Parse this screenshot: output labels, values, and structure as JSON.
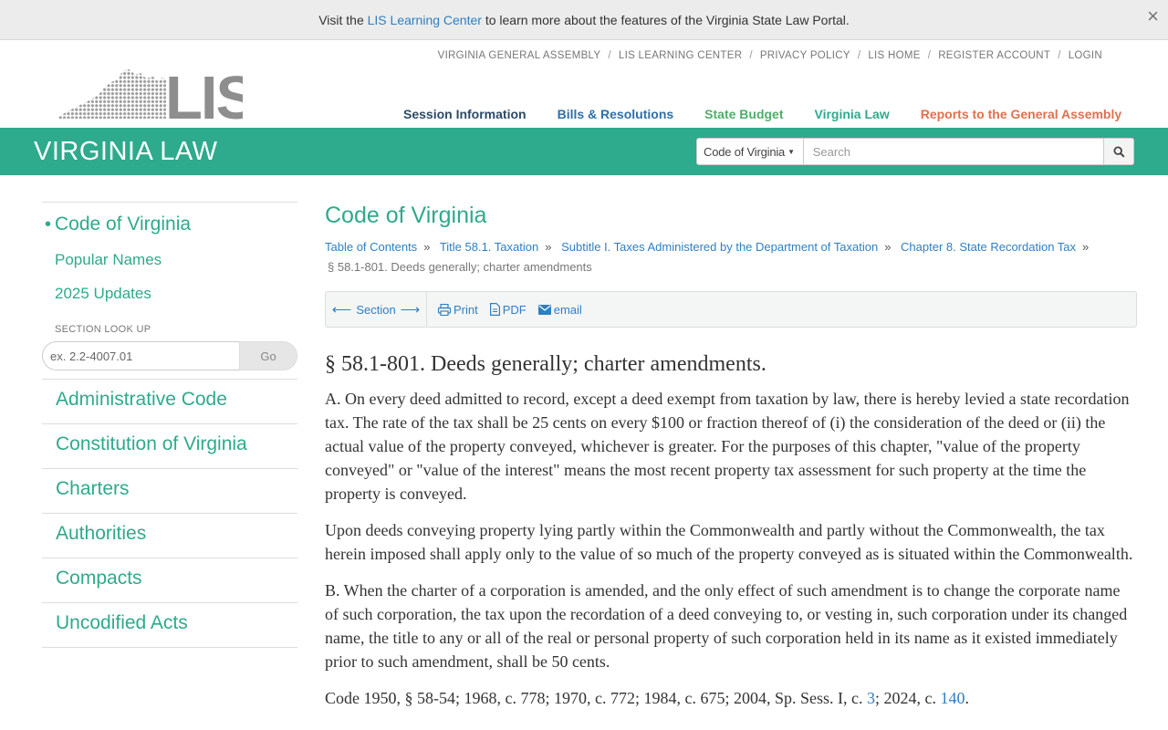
{
  "notice": {
    "prefix": "Visit the",
    "link": "LIS Learning Center",
    "suffix": "to learn more about the features of the Virginia State Law Portal.",
    "close": "×"
  },
  "utility_links": [
    "VIRGINIA GENERAL ASSEMBLY",
    "LIS LEARNING CENTER",
    "PRIVACY POLICY",
    "LIS HOME",
    "REGISTER ACCOUNT",
    "LOGIN"
  ],
  "logo": {
    "text": "LIS"
  },
  "main_nav": [
    {
      "label": "Session Information",
      "color": "#2c4a66"
    },
    {
      "label": "Bills & Resolutions",
      "color": "#2f6fa8"
    },
    {
      "label": "State Budget",
      "color": "#4fae6a"
    },
    {
      "label": "Virginia Law",
      "color": "#2eaa8c"
    },
    {
      "label": "Reports to the General Assembly",
      "color": "#e0704f"
    }
  ],
  "header": {
    "title": "VIRGINIA LAW",
    "search_scope": "Code of Virginia",
    "search_placeholder": "Search"
  },
  "sidebar": {
    "primary": "Code of Virginia",
    "sub_items": [
      "Popular Names",
      "2025 Updates"
    ],
    "lookup_label": "SECTION LOOK UP",
    "lookup_placeholder": "ex. 2.2-4007.01",
    "lookup_go": "Go",
    "groups": [
      "Administrative Code",
      "Constitution of Virginia",
      "Charters",
      "Authorities",
      "Compacts",
      "Uncodified Acts"
    ]
  },
  "main": {
    "heading": "Code of Virginia",
    "breadcrumbs": [
      "Table of Contents",
      "Title 58.1. Taxation",
      "Subtitle I. Taxes Administered by the Department of Taxation",
      "Chapter 8. State Recordation Tax"
    ],
    "current": "§ 58.1-801. Deeds generally; charter amendments",
    "toolbar": {
      "section": "Section",
      "print": "Print",
      "pdf": "PDF",
      "email": "email"
    },
    "section_title": "§ 58.1-801. Deeds generally; charter amendments.",
    "paragraphs": [
      "A. On every deed admitted to record, except a deed exempt from taxation by law, there is hereby levied a state recordation tax. The rate of the tax shall be 25 cents on every $100 or fraction thereof of (i) the consideration of the deed or (ii) the actual value of the property conveyed, whichever is greater. For the purposes of this chapter, \"value of the property conveyed\" or \"value of the interest\" means the most recent property tax assessment for such property at the time the property is conveyed.",
      "Upon deeds conveying property lying partly within the Commonwealth and partly without the Commonwealth, the tax herein imposed shall apply only to the value of so much of the property conveyed as is situated within the Commonwealth.",
      "B. When the charter of a corporation is amended, and the only effect of such amendment is to change the corporate name of such corporation, the tax upon the recordation of a deed conveying to, or vesting in, such corporation under its changed name, the title to any or all of the real or personal property of such corporation held in its name as it existed immediately prior to such amendment, shall be 50 cents."
    ],
    "history": {
      "prefix": "Code 1950, § 58-54; 1968, c. 778; 1970, c. 772; 1984, c. 675; 2004, Sp. Sess. I, c.",
      "link1": "3",
      "middle": "; 2024, c.",
      "link2": "140",
      "suffix": "."
    }
  }
}
